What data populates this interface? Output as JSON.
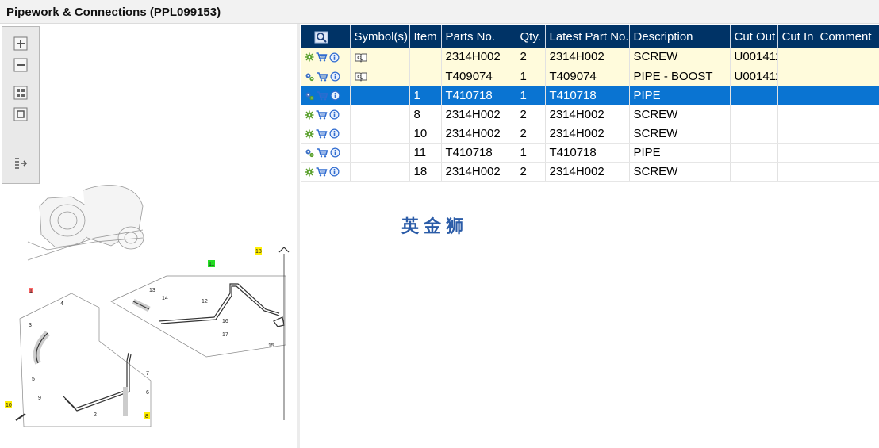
{
  "window": {
    "title": "Pipework & Connections (PPL099153)"
  },
  "toolbar": {
    "buttons": [
      {
        "name": "zoom-in-icon"
      },
      {
        "name": "zoom-out-icon"
      },
      {
        "name": "fit-grid-icon"
      },
      {
        "name": "fit-page-icon"
      },
      {
        "name": "export-list-icon"
      }
    ]
  },
  "diagram": {
    "callouts": [
      "1",
      "2",
      "3",
      "4",
      "5",
      "6",
      "7",
      "8",
      "9",
      "10",
      "11",
      "12",
      "13",
      "14",
      "15",
      "16",
      "17",
      "18"
    ],
    "highlight_colors": {
      "yellow": "#ffee00",
      "green": "#22dd22",
      "red": "#ff6666"
    }
  },
  "table": {
    "headers": {
      "icons": "",
      "symbols": "Symbol(s)",
      "item": "Item",
      "parts_no": "Parts No.",
      "qty": "Qty.",
      "latest_part_no": "Latest Part No.",
      "description": "Description",
      "cut_out": "Cut Out",
      "cut_in": "Cut In",
      "comment": "Comment"
    },
    "rows": [
      {
        "item": "",
        "parts_no": "2314H002",
        "qty": "2",
        "latest_part_no": "2314H002",
        "description": "SCREW",
        "cut_out": "U001411",
        "cut_in": "",
        "comment": "",
        "symbol": "book-icon",
        "state": "highlight"
      },
      {
        "item": "",
        "parts_no": "T409074",
        "qty": "1",
        "latest_part_no": "T409074",
        "description": "PIPE - BOOST",
        "cut_out": "U001411",
        "cut_in": "",
        "comment": "",
        "symbol": "book-icon",
        "state": "highlight"
      },
      {
        "item": "1",
        "parts_no": "T410718",
        "qty": "1",
        "latest_part_no": "T410718",
        "description": "PIPE",
        "cut_out": "",
        "cut_in": "",
        "comment": "",
        "symbol": "",
        "state": "selected"
      },
      {
        "item": "8",
        "parts_no": "2314H002",
        "qty": "2",
        "latest_part_no": "2314H002",
        "description": "SCREW",
        "cut_out": "",
        "cut_in": "",
        "comment": "",
        "symbol": "",
        "state": "normal"
      },
      {
        "item": "10",
        "parts_no": "2314H002",
        "qty": "2",
        "latest_part_no": "2314H002",
        "description": "SCREW",
        "cut_out": "",
        "cut_in": "",
        "comment": "",
        "symbol": "",
        "state": "normal"
      },
      {
        "item": "11",
        "parts_no": "T410718",
        "qty": "1",
        "latest_part_no": "T410718",
        "description": "PIPE",
        "cut_out": "",
        "cut_in": "",
        "comment": "",
        "symbol": "",
        "state": "normal"
      },
      {
        "item": "18",
        "parts_no": "2314H002",
        "qty": "2",
        "latest_part_no": "2314H002",
        "description": "SCREW",
        "cut_out": "",
        "cut_in": "",
        "comment": "",
        "symbol": "",
        "state": "normal"
      }
    ]
  },
  "watermark": {
    "text": "英金狮"
  },
  "colors": {
    "header_bg": "#003366",
    "selected_bg": "#0a74d2",
    "highlight_bg": "#fffbdc",
    "watermark": "#2b5ca8"
  }
}
